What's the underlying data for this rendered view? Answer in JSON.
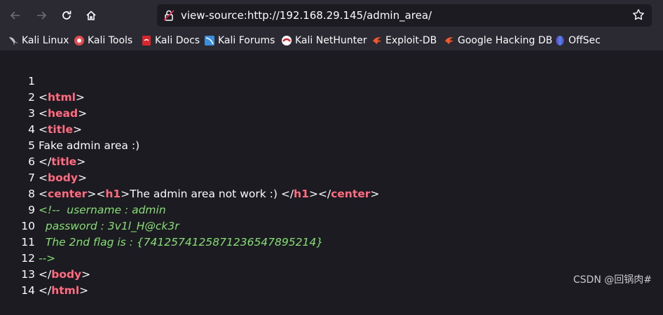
{
  "browser": {
    "url": "view-source:http://192.168.29.145/admin_area/",
    "icons": [
      "back-icon",
      "forward-icon",
      "reload-icon",
      "home-icon",
      "lock-icon",
      "star-icon"
    ]
  },
  "bookmarks": [
    {
      "label": "Kali Linux",
      "icon": "kali-dragon-icon",
      "color": "#c0c0c0"
    },
    {
      "label": "Kali Tools",
      "icon": "kali-tools-icon",
      "color": "#e14e4e"
    },
    {
      "label": "Kali Docs",
      "icon": "kali-docs-icon",
      "color": "#d8262a"
    },
    {
      "label": "Kali Forums",
      "icon": "kali-forums-icon",
      "color": "#3c8ede"
    },
    {
      "label": "Kali NetHunter",
      "icon": "nethunter-icon",
      "color": "#d0242b"
    },
    {
      "label": "Exploit-DB",
      "icon": "exploitdb-icon",
      "color": "#f1572a"
    },
    {
      "label": "Google Hacking DB",
      "icon": "ghdb-icon",
      "color": "#f1572a"
    },
    {
      "label": "OffSec",
      "icon": "offsec-icon",
      "color": "#6a52d9"
    }
  ],
  "source": {
    "line_numbers": [
      "1",
      "2",
      "3",
      "4",
      "5",
      "6",
      "7",
      "8",
      "9",
      "10",
      "11",
      "12",
      "13",
      "14"
    ],
    "l1_tag": "html",
    "l2_tag": "head",
    "l3_tag": "title",
    "l4_text": "Fake admin area :)",
    "l5_tag": "title",
    "l6_tag": "body",
    "l7_tag_center": "center",
    "l7_tag_h1": "h1",
    "l7_text": "The admin area not work :) ",
    "l8_comment": "<!--  username : admin",
    "l9_comment": "  password : 3v1l_H@ck3r",
    "l10_comment": "  The 2nd flag is : {7412574125871236547895214}",
    "l11_comment": "-->",
    "l12_tag": "body",
    "l13_tag": "html",
    "p_lt": "<",
    "p_gt": ">",
    "p_lt_slash": "</"
  },
  "watermark": "CSDN @回锅肉#",
  "colors": {
    "tag": "#ff6b7f",
    "comment": "#86de74",
    "background": "#1c1b22",
    "toolbar": "#2b2a33"
  }
}
